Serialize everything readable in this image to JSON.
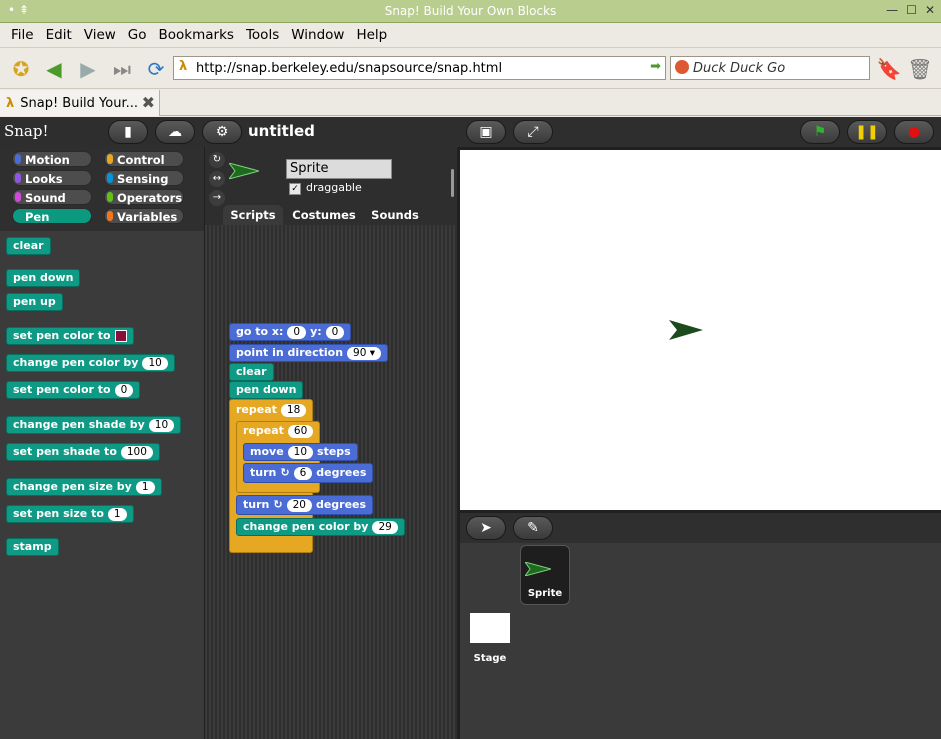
{
  "window": {
    "title": "Snap! Build Your Own Blocks"
  },
  "menubar": {
    "items": [
      "File",
      "Edit",
      "View",
      "Go",
      "Bookmarks",
      "Tools",
      "Window",
      "Help"
    ]
  },
  "navbar": {
    "url": "http://snap.berkeley.edu/snapsource/snap.html",
    "search_placeholder": "Duck Duck Go"
  },
  "tabs": [
    {
      "label": "Snap! Build Your..."
    }
  ],
  "snap": {
    "logo": "Snap!",
    "project_name": "untitled",
    "categories": [
      "Motion",
      "Control",
      "Looks",
      "Sensing",
      "Sound",
      "Operators",
      "Pen",
      "Variables"
    ],
    "selected_category": "Pen",
    "palette": {
      "clear": "clear",
      "pen_down": "pen down",
      "pen_up": "pen up",
      "set_pen_color_to": "set pen color to",
      "change_pen_color_by": "change pen color by",
      "change_pen_color_by_val": "10",
      "set_pen_color_to_num": "set pen color to",
      "set_pen_color_to_num_val": "0",
      "change_pen_shade_by": "change pen shade by",
      "change_pen_shade_by_val": "10",
      "set_pen_shade_to": "set pen shade to",
      "set_pen_shade_to_val": "100",
      "change_pen_size_by": "change pen size by",
      "change_pen_size_by_val": "1",
      "set_pen_size_to": "set pen size to",
      "set_pen_size_to_val": "1",
      "stamp": "stamp"
    },
    "sprite": {
      "name": "Sprite",
      "draggable_label": "draggable"
    },
    "sprite_tabs": [
      "Scripts",
      "Costumes",
      "Sounds"
    ],
    "script": {
      "goto": "go to x:",
      "goto_x": "0",
      "goto_y_label": "y:",
      "goto_y": "0",
      "point": "point in direction",
      "point_val": "90",
      "clear": "clear",
      "pen_down": "pen down",
      "repeat1": "repeat",
      "repeat1_val": "18",
      "repeat2": "repeat",
      "repeat2_val": "60",
      "move": "move",
      "move_val": "10",
      "move_suffix": "steps",
      "turn1": "turn",
      "turn1_val": "6",
      "turn1_suffix": "degrees",
      "turn2": "turn",
      "turn2_val": "20",
      "turn2_suffix": "degrees",
      "change_color": "change pen color by",
      "change_color_val": "29"
    },
    "corral": {
      "sprite_label": "Sprite",
      "stage_label": "Stage"
    }
  }
}
